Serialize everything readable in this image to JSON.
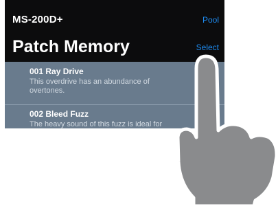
{
  "header": {
    "device_name": "MS-200D+",
    "pool_label": "Pool",
    "title": "Patch Memory",
    "select_label": "Select"
  },
  "patches": [
    {
      "name": "001 Ray Drive",
      "description": "This overdrive has an abundance of overtones."
    },
    {
      "name": "002 Bleed Fuzz",
      "description": "The heavy sound of this fuzz is ideal for"
    }
  ],
  "colors": {
    "background": "#0c0c0d",
    "accent": "#1e8bf0",
    "list_background": "#697b8d",
    "hand": "#8a8b8d"
  },
  "overlay": {
    "icon": "tap-hand-icon"
  }
}
